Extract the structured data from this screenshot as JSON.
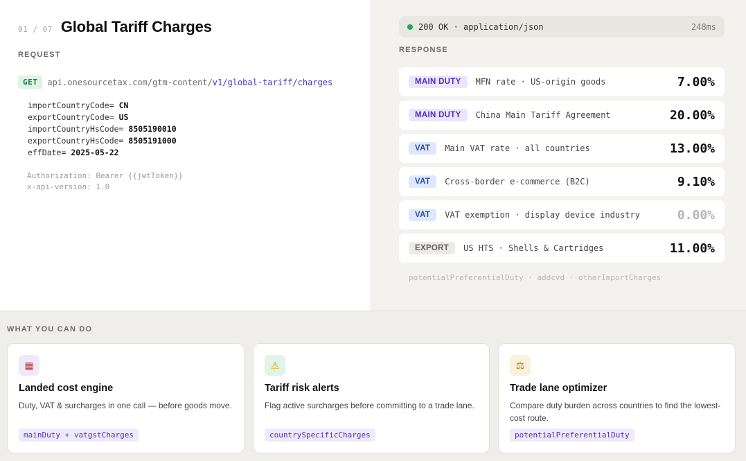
{
  "request": {
    "counter": "01 / 07",
    "title": "Global Tariff Charges",
    "section_label": "REQUEST",
    "method": "GET",
    "url_prefix": "api.onesourcetax.com/gtm-content/",
    "url_path": "v1/global-tariff/charges",
    "params": [
      {
        "key": "importCountryCode=",
        "value": "CN"
      },
      {
        "key": "exportCountryCode=",
        "value": "US"
      },
      {
        "key": "importCountryHsCode=",
        "value": "8505190010"
      },
      {
        "key": "exportCountryHsCode=",
        "value": "8505191000"
      },
      {
        "key": "effDate=",
        "value": "2025-05-22"
      }
    ],
    "headers": [
      "Authorization: Bearer {{jwtToken}}",
      "x-api-version: 1.0"
    ]
  },
  "response": {
    "status_text": "200 OK · application/json",
    "status_color": "#1aab55",
    "latency": "248ms",
    "section_label": "RESPONSE",
    "rows": [
      {
        "badge": "MAIN DUTY",
        "kind": "duty",
        "desc": "MFN rate · US-origin goods",
        "rate": "7.00%"
      },
      {
        "badge": "MAIN DUTY",
        "kind": "duty",
        "desc": "China Main Tariff Agreement",
        "rate": "20.00%"
      },
      {
        "badge": "VAT",
        "kind": "vat",
        "desc": "Main VAT rate · all countries",
        "rate": "13.00%"
      },
      {
        "badge": "VAT",
        "kind": "vat",
        "desc": "Cross-border e-commerce (B2C)",
        "rate": "9.10%"
      },
      {
        "badge": "VAT",
        "kind": "vat",
        "desc": "VAT exemption · display device industry",
        "rate": "0.00%",
        "dim": true
      },
      {
        "badge": "EXPORT",
        "kind": "export",
        "desc": "US HTS · Shells & Cartridges",
        "rate": "11.00%"
      }
    ],
    "footnote": "potentialPreferentialDuty · addcvd · otherImportCharges"
  },
  "bottom": {
    "section_label": "WHAT YOU CAN DO",
    "cards": [
      {
        "icon": "calculator-icon",
        "icon_glyph": "▦",
        "icon_bg": "#efe8fb",
        "icon_color": "#c0392b",
        "title": "Landed cost engine",
        "desc": "Duty, VAT & surcharges in one call — before goods move.",
        "chip": "mainDuty + vatgstCharges"
      },
      {
        "icon": "warning-icon",
        "icon_glyph": "⚠",
        "icon_bg": "#dff5e8",
        "icon_color": "#e6a100",
        "title": "Tariff risk alerts",
        "desc": "Flag active surcharges before committing to a trade lane.",
        "chip": "countrySpecificCharges"
      },
      {
        "icon": "scales-icon",
        "icon_glyph": "⚖",
        "icon_bg": "#fbf0d9",
        "icon_color": "#b07a1a",
        "title": "Trade lane optimizer",
        "desc": "Compare duty burden across countries to find the lowest-cost route.",
        "chip": "potentialPreferentialDuty"
      }
    ]
  }
}
